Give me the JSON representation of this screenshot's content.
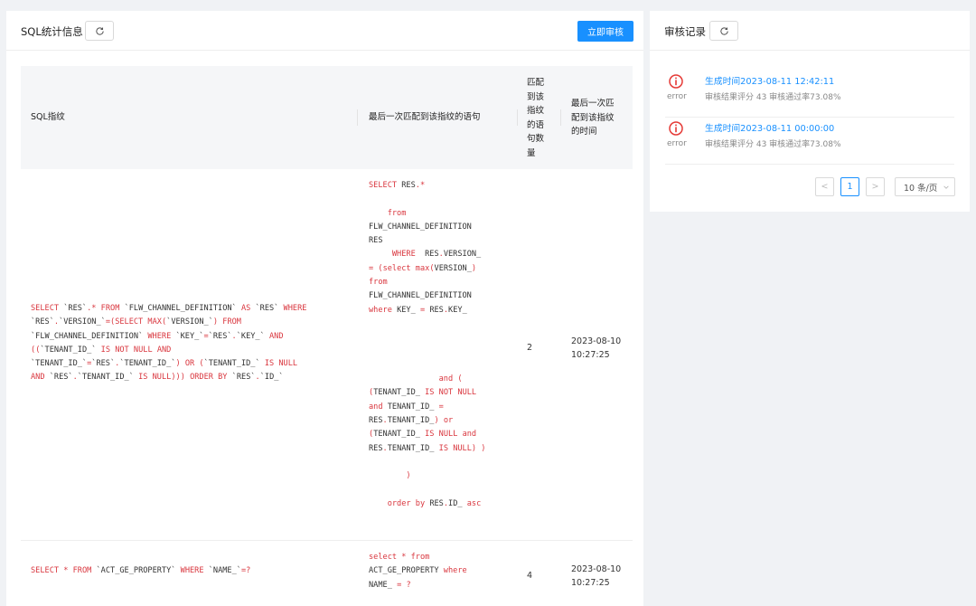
{
  "left_panel": {
    "title": "SQL统计信息",
    "audit_button": "立即审核",
    "table": {
      "headers": {
        "fingerprint": "SQL指纹",
        "last_statement": "最后一次匹配到该指纹的语句",
        "match_count": "匹配\n到该\n指纹\n的语\n句数\n量",
        "last_time": "最后一次匹\n配到该指纹\n的时间"
      },
      "rows": [
        {
          "fingerprint": "SELECT `RES`.* FROM `FLW_CHANNEL_DEFINITION` AS `RES` WHERE\n`RES`.`VERSION_`=(SELECT MAX(`VERSION_`) FROM\n`FLW_CHANNEL_DEFINITION` WHERE `KEY_`=`RES`.`KEY_` AND\n((`TENANT_ID_` IS NOT NULL AND\n`TENANT_ID_`=`RES`.`TENANT_ID_`) OR (`TENANT_ID_` IS NULL\nAND `RES`.`TENANT_ID_` IS NULL))) ORDER BY `RES`.`ID_`",
          "statement": "SELECT RES.*\n\n    from\nFLW_CHANNEL_DEFINITION\nRES\n     WHERE  RES.VERSION_\n= (select max(VERSION_)\nfrom\nFLW_CHANNEL_DEFINITION\nwhere KEY_ = RES.KEY_\n\n\n\n\n               and (\n(TENANT_ID_ IS NOT NULL\nand TENANT_ID_ =\nRES.TENANT_ID_) or\n(TENANT_ID_ IS NULL and\nRES.TENANT_ID_ IS NULL) )\n\n        )\n\n    order by RES.ID_ asc",
          "count": "2",
          "time": "2023-08-10\n10:27:25"
        },
        {
          "fingerprint": "SELECT * FROM `ACT_GE_PROPERTY` WHERE `NAME_`=?",
          "statement": "select * from\nACT_GE_PROPERTY where\nNAME_ = ?",
          "count": "4",
          "time": "2023-08-10\n10:27:25"
        }
      ]
    }
  },
  "right_panel": {
    "title": "审核记录",
    "records": [
      {
        "status": "error",
        "time": "生成时间2023-08-11 12:42:11",
        "meta": "审核结果评分 43  审核通过率73.08%"
      },
      {
        "status": "error",
        "time": "生成时间2023-08-11 00:00:00",
        "meta": "审核结果评分 43  审核通过率73.08%"
      }
    ],
    "pagination": {
      "prev": "<",
      "current": "1",
      "next": ">",
      "page_size": "10 条/页"
    }
  },
  "colors": {
    "primary": "#1890ff",
    "error": "#e53935",
    "keyword": "#d9363e"
  },
  "icons": {
    "refresh": "refresh-icon",
    "error": "error-circle-icon",
    "chevron": "chevron-down-icon"
  }
}
